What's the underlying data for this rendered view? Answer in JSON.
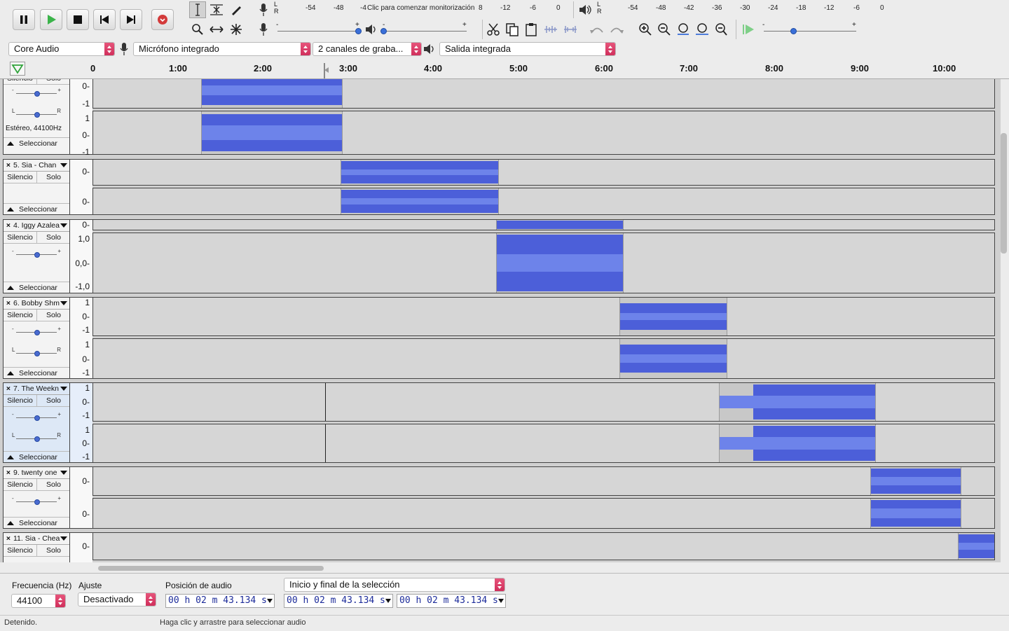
{
  "toolbar": {
    "record_meter_scale": [
      "-54",
      "-48",
      "-4",
      "8",
      "-12",
      "-6",
      "0"
    ],
    "record_meter_hint": "Clic para comenzar monitorización",
    "play_meter_scale": [
      "-54",
      "-48",
      "-42",
      "-36",
      "-30",
      "-24",
      "-18",
      "-12",
      "-6",
      "0"
    ],
    "meter_channels": [
      "L",
      "R"
    ],
    "slider_minus": "-",
    "slider_plus": "+",
    "colors": {
      "record": "#d33b3b",
      "play": "#3bb44a",
      "accent": "#4c5fd9"
    }
  },
  "devices": {
    "host": "Core Audio",
    "input": "Micrófono integrado",
    "channels": "2 canales de graba...",
    "output": "Salida integrada"
  },
  "timeline": {
    "labels": [
      "0",
      "1:00",
      "2:00",
      "3:00",
      "4:00",
      "5:00",
      "6:00",
      "7:00",
      "8:00",
      "9:00",
      "10:00"
    ]
  },
  "tracks": {
    "common": {
      "mute": "Silencio",
      "solo": "Solo",
      "select": "Seleccionar",
      "close": "×"
    },
    "t0": {
      "info": "Estéreo, 44100Hz",
      "r1": [
        "0-",
        "-1"
      ],
      "r2": [
        "1",
        "0-",
        "-1"
      ]
    },
    "t1": {
      "name": "5. Sia - Chan",
      "r1": [
        "0-"
      ],
      "r2": [
        "0-"
      ]
    },
    "t2": {
      "name": "4. Iggy Azalea",
      "r1": [
        "0-"
      ],
      "r2": [
        "1,0",
        "0,0-",
        "-1,0"
      ]
    },
    "t3": {
      "name": "6. Bobby Shm",
      "r1": [
        "1",
        "0-",
        "-1"
      ],
      "r2": [
        "1",
        "0-",
        "-1"
      ]
    },
    "t4": {
      "name": "7. The Weekn",
      "r1": [
        "1",
        "0-",
        "-1"
      ],
      "r2": [
        "1",
        "0-",
        "-1"
      ]
    },
    "t5": {
      "name": "9. twenty one",
      "r1": [
        "0-"
      ],
      "r2": [
        "0-"
      ]
    },
    "t6": {
      "name": "11. Sia - Chea",
      "r1": [
        "0-"
      ]
    }
  },
  "selection_bar": {
    "rate_label": "Frecuencia (Hz)",
    "rate_value": "44100",
    "snap_label": "Ajuste",
    "snap_value": "Desactivado",
    "position_label": "Posición de audio",
    "position_value": "00 h 02 m 43.134 s",
    "selection_mode": "Inicio y final de la selección",
    "sel_start": "00 h 02 m 43.134 s",
    "sel_end": "00 h 02 m 43.134 s"
  },
  "status": {
    "state": "Detenido.",
    "hint": "Haga clic y arrastre para seleccionar audio"
  }
}
